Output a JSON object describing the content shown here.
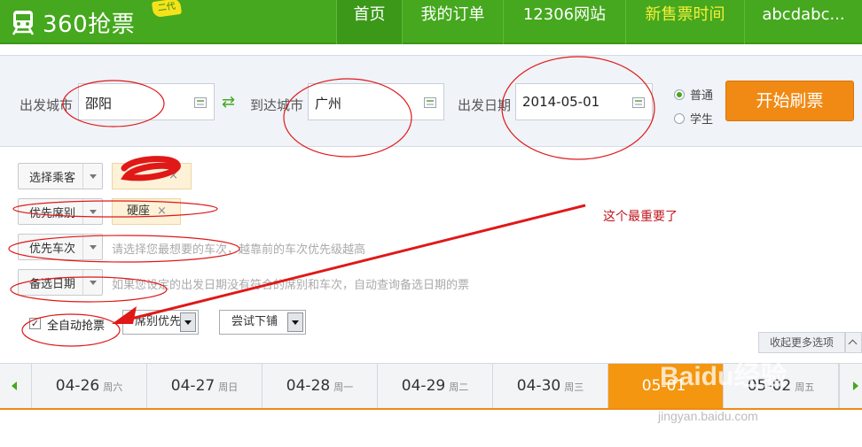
{
  "header": {
    "logo_text": "360抢票",
    "logo_badge": "二代",
    "nav": [
      {
        "label": "首页"
      },
      {
        "label": "我的订单"
      },
      {
        "label": "12306网站"
      },
      {
        "label": "新售票时间"
      },
      {
        "label": "abcdabc..."
      }
    ]
  },
  "search": {
    "from_label": "出发城市",
    "from_value": "邵阳",
    "to_label": "到达城市",
    "to_value": "广州",
    "date_label": "出发日期",
    "date_value": "2014-05-01",
    "ticket_types": [
      {
        "label": "普通",
        "selected": true
      },
      {
        "label": "学生",
        "selected": false
      }
    ],
    "start_button": "开始刷票"
  },
  "options": {
    "passenger_btn": "选择乘客",
    "seat_btn": "优先席别",
    "seat_tag": "硬座",
    "train_btn": "优先车次",
    "train_hint": "请选择您最想要的车次，越靠前的车次优先级越高",
    "date_btn": "备选日期",
    "date_hint": "如果您设定的出发日期没有符合的席别和车次，自动查询备选日期的票",
    "auto_label": "全自动抢票",
    "priority_select": "席别优先",
    "berth_select": "尝试下铺",
    "collapse": "收起更多选项",
    "tag_close": "×"
  },
  "dates": [
    {
      "date": "04-26",
      "week": "周六"
    },
    {
      "date": "04-27",
      "week": "周日"
    },
    {
      "date": "04-28",
      "week": "周一"
    },
    {
      "date": "04-29",
      "week": "周二"
    },
    {
      "date": "04-30",
      "week": "周三"
    },
    {
      "date": "05-01",
      "week": "",
      "active": true
    },
    {
      "date": "05-02",
      "week": "周五"
    }
  ],
  "annotation": {
    "note": "这个最重要了",
    "color": "#e01818"
  },
  "watermark": {
    "brand": "Baidu经验",
    "url": "jingyan.baidu.com"
  },
  "colors": {
    "brand_green": "#45a81e",
    "accent_orange": "#f08a14"
  }
}
